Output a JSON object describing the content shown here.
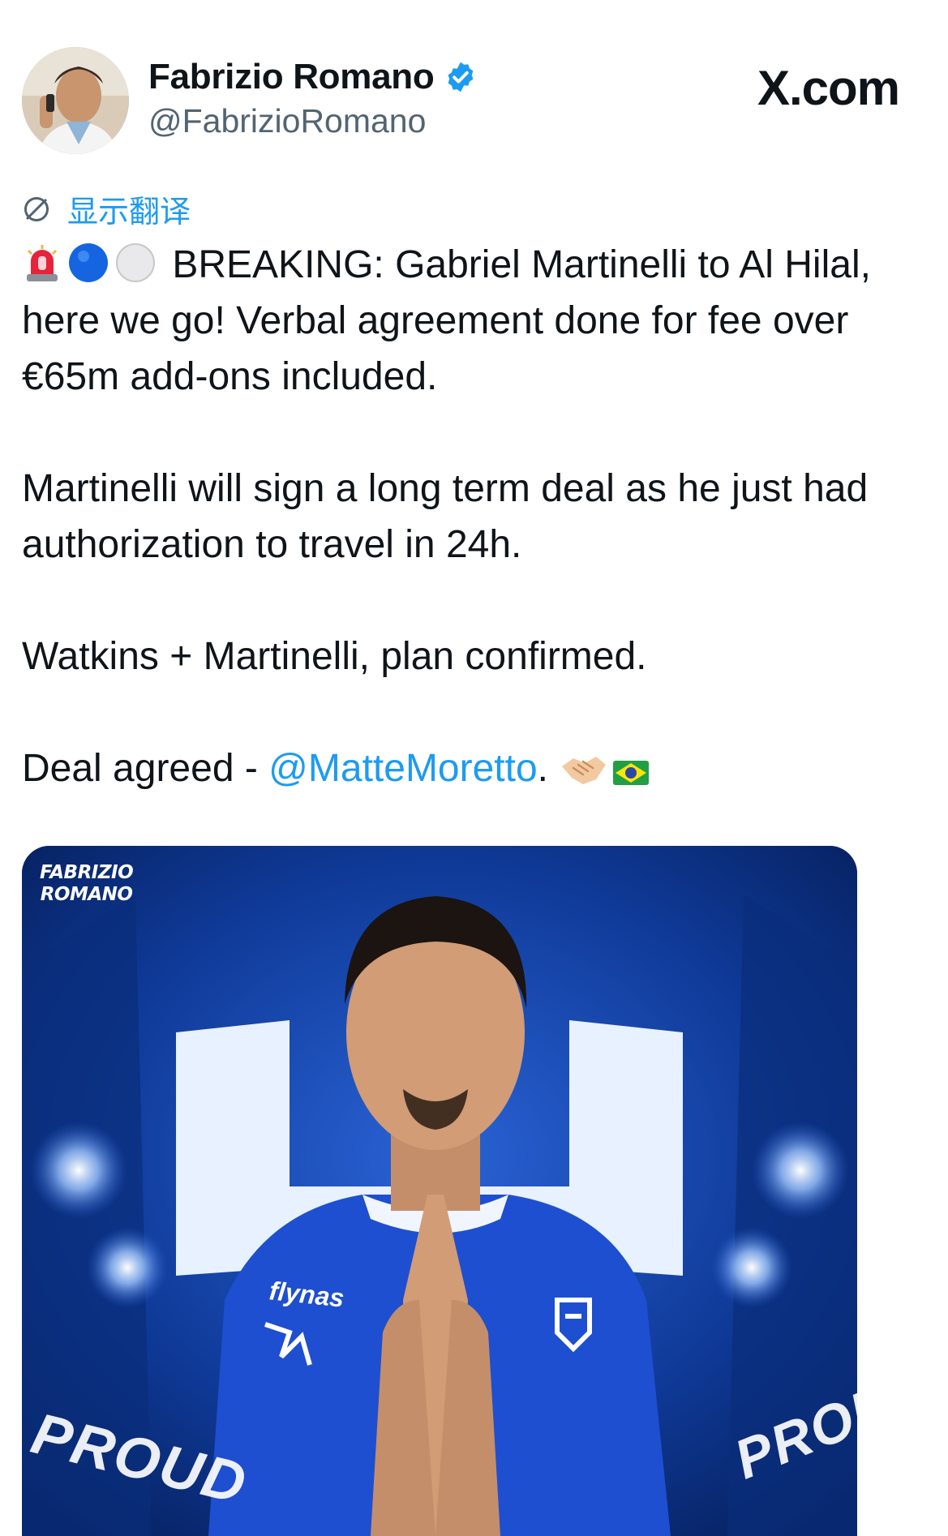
{
  "author": {
    "display_name": "Fabrizio Romano",
    "handle": "@FabrizioRomano",
    "verified": true,
    "avatar_icon": "avatar-photo"
  },
  "brand": {
    "label": "X.com"
  },
  "translate": {
    "icon": "translate-globe-icon",
    "label": "显示翻译"
  },
  "tweet": {
    "line1_emojis": [
      "siren-emoji",
      "blue-circle-emoji",
      "white-circle-emoji"
    ],
    "line1_text": "BREAKING: Gabriel Martinelli to Al Hilal, here we go! Verbal agreement done for fee over €65m add-ons included.",
    "paragraph2": "Martinelli will sign a long term deal as he just had authorization to travel in 24h.",
    "paragraph3": "Watkins + Martinelli, plan confirmed.",
    "paragraph4_prefix": "Deal agreed - ",
    "mention": "@MatteMoretto",
    "paragraph4_suffix": ".",
    "trailing_emojis": [
      "handshake-emoji",
      "brazil-flag-emoji"
    ]
  },
  "media": {
    "watermark_line1": "FABRIZIO",
    "watermark_line2": "ROMANO",
    "sponsor": "flynas",
    "banner_left": "PROUD",
    "banner_right": "PROUD"
  },
  "colors": {
    "link": "#1d9bf0",
    "secondary_text": "#536471",
    "media_blue": "#0a2a73"
  }
}
